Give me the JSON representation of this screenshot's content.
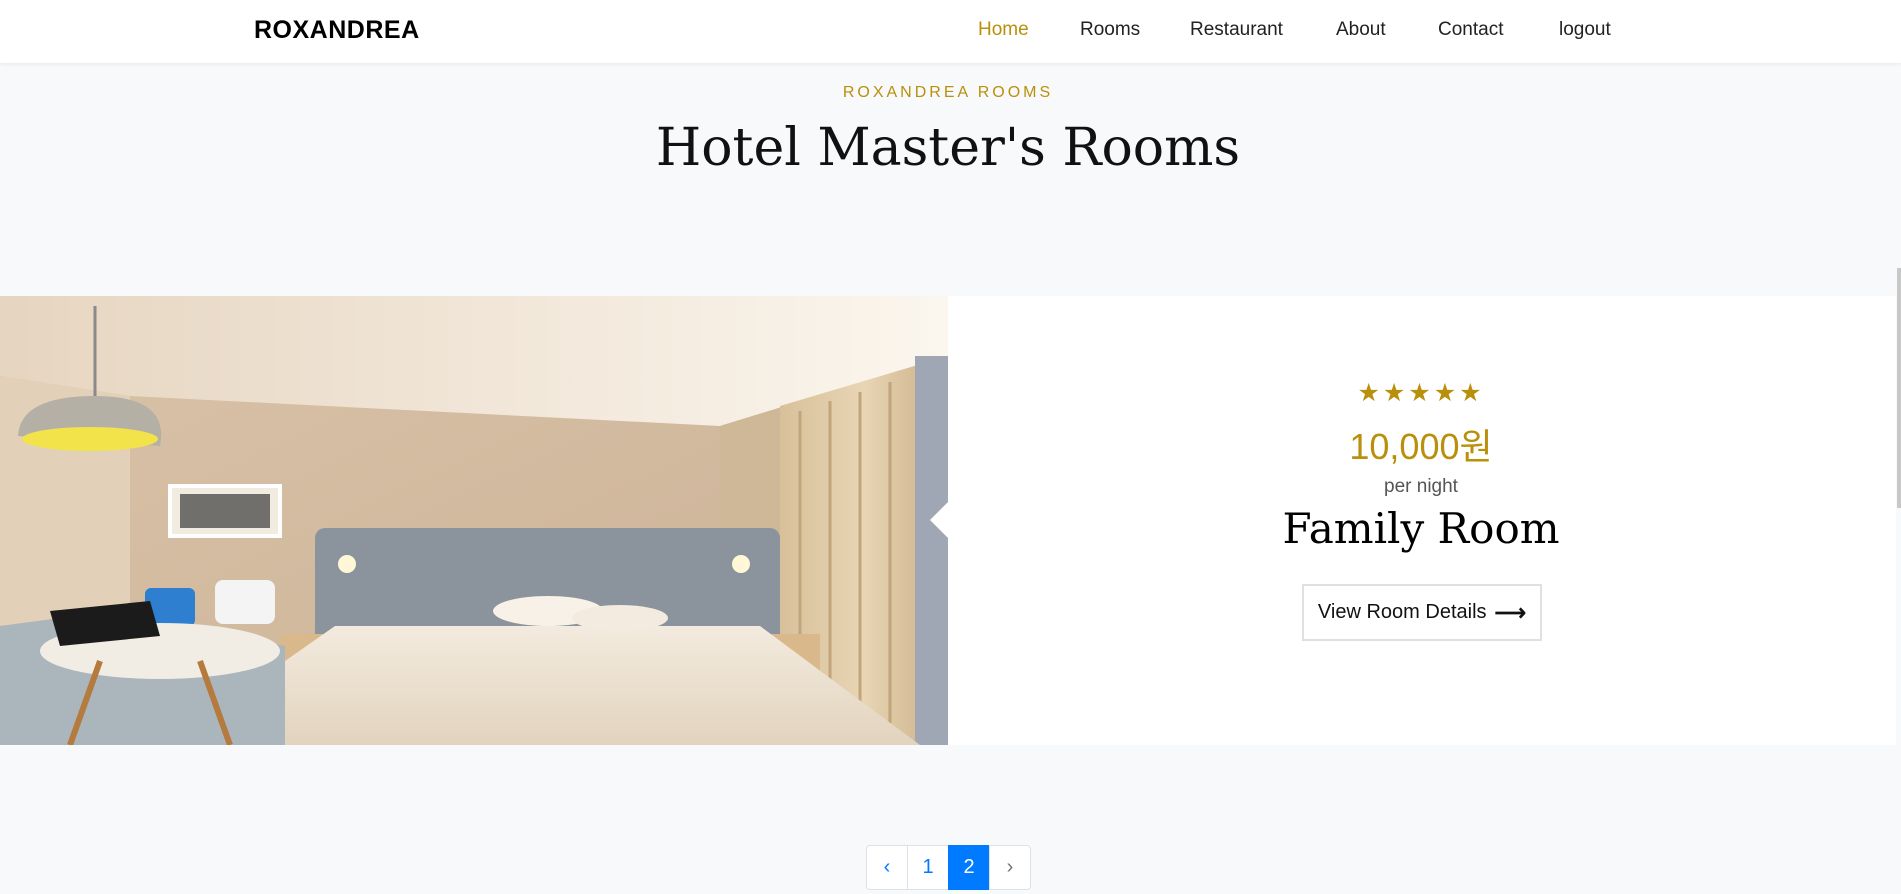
{
  "navbar": {
    "brand": "ROXANDREA",
    "links": [
      {
        "label": "Home",
        "active": true
      },
      {
        "label": "Rooms",
        "active": false
      },
      {
        "label": "Restaurant",
        "active": false
      },
      {
        "label": "About",
        "active": false
      },
      {
        "label": "Contact",
        "active": false
      },
      {
        "label": "logout",
        "active": false
      }
    ]
  },
  "header": {
    "subtitle": "ROXANDREA ROOMS",
    "title": "Hotel Master's Rooms"
  },
  "room": {
    "rating": 5,
    "stars": "★★★★★",
    "price": "10,000원",
    "per_night": "per night",
    "name": "Family Room",
    "details_label": "View Room Details",
    "details_icon": "arrow-right-icon"
  },
  "pagination": {
    "prev": "‹",
    "pages": [
      "1",
      "2"
    ],
    "current_page": "2",
    "next": "›"
  },
  "colors": {
    "accent": "#b8900b",
    "page_active": "#007bff",
    "background": "#f8f9fb"
  }
}
